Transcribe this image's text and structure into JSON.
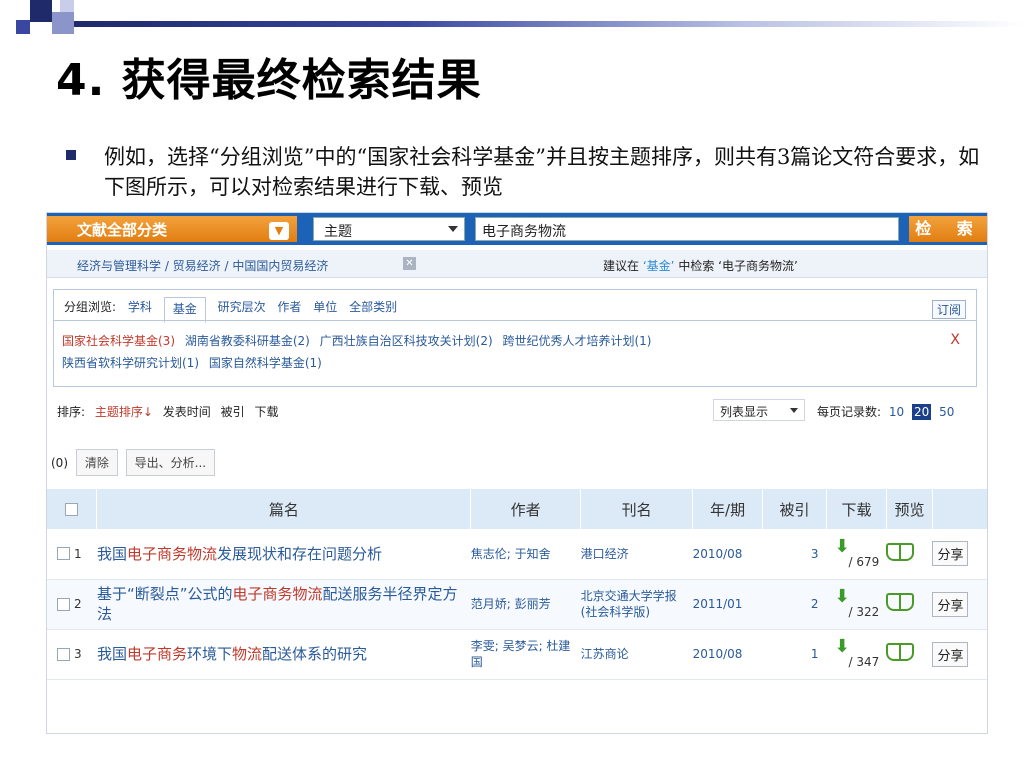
{
  "slide": {
    "title": "4. 获得最终检索结果",
    "bullet": "例如，选择“分组浏览”中的“国家社会科学基金”并且按主题排序，则共有3篇论文符合要求，如下图所示，可以对检索结果进行下载、预览"
  },
  "search": {
    "category": "文献全部分类",
    "field": "主题",
    "query": "电子商务物流",
    "button": "检 索"
  },
  "crumbs": {
    "path": "经济与管理科学 / 贸易经济 / 中国国内贸易经济",
    "suggest_prefix": "建议在",
    "suggest_fund": "‘基金’",
    "suggest_suffix": "中检索 ‘电子商务物流’"
  },
  "group": {
    "label": "分组浏览:",
    "tabs": [
      "学科",
      "基金",
      "研究层次",
      "作者",
      "单位",
      "全部类别"
    ],
    "subscribe": "订阅",
    "items": [
      {
        "text": "国家社会科学基金(3)",
        "selected": true
      },
      {
        "text": "湖南省教委科研基金(2)"
      },
      {
        "text": "广西壮族自治区科技攻关计划(2)"
      },
      {
        "text": "跨世纪优秀人才培养计划(1)"
      },
      {
        "text": "陕西省软科学研究计划(1)"
      },
      {
        "text": "国家自然科学基金(1)"
      }
    ],
    "close": "X"
  },
  "sort": {
    "label": "排序:",
    "options": [
      "主题排序↓",
      "发表时间",
      "被引",
      "下载"
    ],
    "view": "列表显示",
    "perpage_label": "每页记录数:",
    "perpage": [
      "10",
      "20",
      "50"
    ]
  },
  "actions": {
    "count": "(0)",
    "clear": "清除",
    "export": "导出、分析..."
  },
  "table": {
    "headers": [
      "篇名",
      "作者",
      "刊名",
      "年/期",
      "被引",
      "下载",
      "预览"
    ],
    "rows": [
      {
        "no": "1",
        "title_pre": "我国",
        "title_kw": "电子商务物流",
        "title_post": "发展现状和存在问题分析",
        "authors": "焦志伦; 于知舍",
        "journal": "港口经济",
        "date": "2010/08",
        "cited": "3",
        "downloads": "/ 679",
        "share": "分享"
      },
      {
        "no": "2",
        "title_pre": "基于“断裂点”公式的",
        "title_kw": "电子商务物流",
        "title_post": "配送服务半径界定方法",
        "authors": "范月娇; 彭丽芳",
        "journal": "北京交通大学学报(社会科学版)",
        "date": "2011/01",
        "cited": "2",
        "downloads": "/ 322",
        "share": "分享"
      },
      {
        "no": "3",
        "title_pre": "我国",
        "title_kw": "电子商务",
        "title_mid": "环境下",
        "title_kw2": "物流",
        "title_post": "配送体系的研究",
        "authors": "李雯; 吴梦云; 杜建国",
        "journal": "江苏商论",
        "date": "2010/08",
        "cited": "1",
        "downloads": "/ 347",
        "share": "分享"
      }
    ]
  },
  "colors": {
    "accent_orange": "#e07e12",
    "nav_blue": "#1c63b7",
    "keyword_red": "#c0392b",
    "title_dark": "#1f2a6b"
  }
}
